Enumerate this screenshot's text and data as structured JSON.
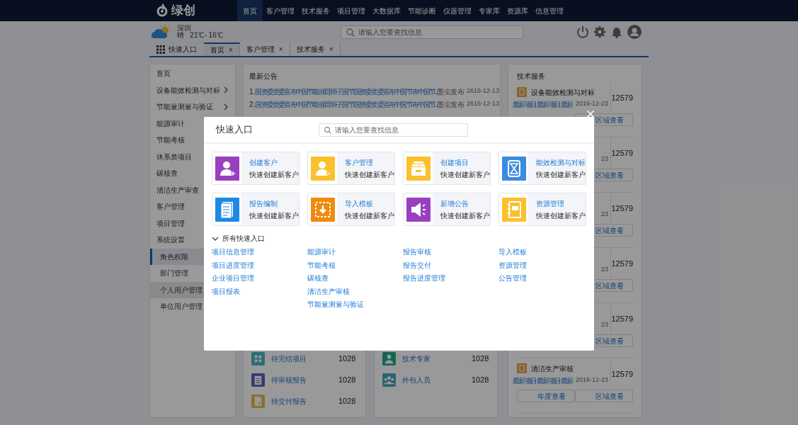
{
  "nav": {
    "logo": "绿创",
    "items": [
      {
        "label": "首页",
        "selected": true
      },
      {
        "label": "客户管理",
        "selected": false
      },
      {
        "label": "技术服务",
        "selected": false
      },
      {
        "label": "项目管理",
        "selected": false
      },
      {
        "label": "大数据库",
        "selected": false
      },
      {
        "label": "节能诊断",
        "selected": false
      },
      {
        "label": "仪器管理",
        "selected": false
      },
      {
        "label": "专家库",
        "selected": false
      },
      {
        "label": "资源库",
        "selected": false
      },
      {
        "label": "信息管理",
        "selected": false
      }
    ]
  },
  "header": {
    "city": "深圳",
    "weather": "晴   21℃- 16℃",
    "search_placeholder": "请输入您要查找信息"
  },
  "tab_bar": {
    "quick_entry": "快速入口",
    "tabs": [
      {
        "label": "首页",
        "selected": true,
        "close": "×"
      },
      {
        "label": "客户管理",
        "selected": false,
        "close": "×"
      },
      {
        "label": "技术服务",
        "selected": false,
        "close": "×"
      }
    ]
  },
  "sidebar": {
    "items": [
      {
        "label": "首页",
        "selected": false
      },
      {
        "label": "设备能效检测与对标",
        "selected": false,
        "expandable": true
      },
      {
        "label": "节能量测量与验证",
        "selected": false,
        "expandable": true
      },
      {
        "label": "能源审计",
        "selected": false
      },
      {
        "label": "节能考核",
        "selected": false
      },
      {
        "label": "休系类项目",
        "selected": false
      },
      {
        "label": "碳核查",
        "selected": false
      },
      {
        "label": "清洁生产审查",
        "selected": false
      },
      {
        "label": "客户管理",
        "selected": false
      },
      {
        "label": "项目管理",
        "selected": false
      },
      {
        "label": "系统设置",
        "selected": false,
        "children": [
          {
            "label": "角色权限",
            "selected": true,
            "hovered": false
          },
          {
            "label": "部门管理",
            "selected": false,
            "hovered": false
          },
          {
            "label": "个人用户管理",
            "selected": false,
            "hovered": true
          },
          {
            "label": "单位用户管理",
            "selected": false,
            "hovered": false
          }
        ]
      }
    ]
  },
  "announcements": {
    "title": "最新公告",
    "rows": [
      {
        "index": "1.",
        "text": "国资委党委宣布中国节能领导班子国节国资委党委宣布中国节布中国节...",
        "source": "墨尘发布",
        "date": "2616-12-13"
      },
      {
        "index": "2.",
        "text": "国资委党委宣布中国节能领导班子国节国资委党委宣布中国节布中国节...",
        "source": "墨尘发布",
        "date": "2616-12-13"
      }
    ]
  },
  "pending": {
    "rows": [
      {
        "kind": "grid",
        "label": "待完结项目",
        "count": "1028"
      },
      {
        "kind": "clipboard",
        "label": "待审核报告",
        "count": "1028"
      },
      {
        "kind": "upload",
        "label": "待交付报告",
        "count": "1028"
      }
    ]
  },
  "people": {
    "rows": [
      {
        "kind": "person",
        "label": "技术专家",
        "count": "1028"
      },
      {
        "kind": "group",
        "label": "外包人员",
        "count": "1028"
      }
    ]
  },
  "tech_services": {
    "title": "技术服务",
    "cards": [
      {
        "title": "设备能效检测与对标",
        "link": "最新项目最新项目最新",
        "date": "2016-12-23",
        "count": "12579",
        "buttons": [
          "区域查看"
        ]
      },
      {
        "date": "23",
        "count": "12579",
        "buttons": [
          "区域查看"
        ]
      },
      {
        "date": "23",
        "count": "12579",
        "buttons": [
          "区域查看"
        ]
      },
      {
        "date": "23",
        "count": "12579",
        "buttons": [
          "区域查看"
        ]
      },
      {
        "date": "23",
        "count": "12579",
        "buttons": [
          "区域查看"
        ]
      },
      {
        "title": "清洁生产审核",
        "link": "最新项目最新项目最新",
        "date": "2016-12-23",
        "count": "12579",
        "buttons": [
          "年度查看",
          "区域查看"
        ]
      }
    ]
  },
  "modal": {
    "title": "快速入口",
    "search_placeholder": "请输入您要查找信息",
    "tiles": [
      {
        "kind": "user-add",
        "color": "#9a3fc0",
        "title": "创建客户",
        "subtitle": "快速创建新客户"
      },
      {
        "kind": "user-check",
        "color": "#fbc02d",
        "title": "客户管理",
        "subtitle": "快速创建新客户"
      },
      {
        "kind": "drawer",
        "color": "#fbc02d",
        "title": "创建项目",
        "subtitle": "快速创建新客户"
      },
      {
        "kind": "hourglass",
        "color": "#3d8be0",
        "title": "能效检测与对标",
        "subtitle": "快速创建新客户"
      },
      {
        "kind": "document",
        "color": "#1e88e5",
        "title": "报告编制",
        "subtitle": "快速创建新客户"
      },
      {
        "kind": "import",
        "color": "#ef8a10",
        "title": "导入模板",
        "subtitle": "快速创建新客户"
      },
      {
        "kind": "megaphone",
        "color": "#9a3fc0",
        "title": "新增公告",
        "subtitle": "快速创建新客户"
      },
      {
        "kind": "notebook",
        "color": "#fbc02d",
        "title": "资源管理",
        "subtitle": "快速创建新客户"
      }
    ],
    "all_label": "所有快速入口",
    "expanded": true,
    "link_columns": [
      [
        "项目信息管理",
        "项目进度管理",
        "企业项目管理",
        "项目报表"
      ],
      [
        "能源审计",
        "节能考核",
        "碳核查",
        "清洁生产审核",
        "节能量测量与验证"
      ],
      [
        "报告审核",
        "报告交付",
        "报告进度管理"
      ],
      [
        "导入模板",
        "资源管理",
        "公告管理"
      ]
    ]
  }
}
